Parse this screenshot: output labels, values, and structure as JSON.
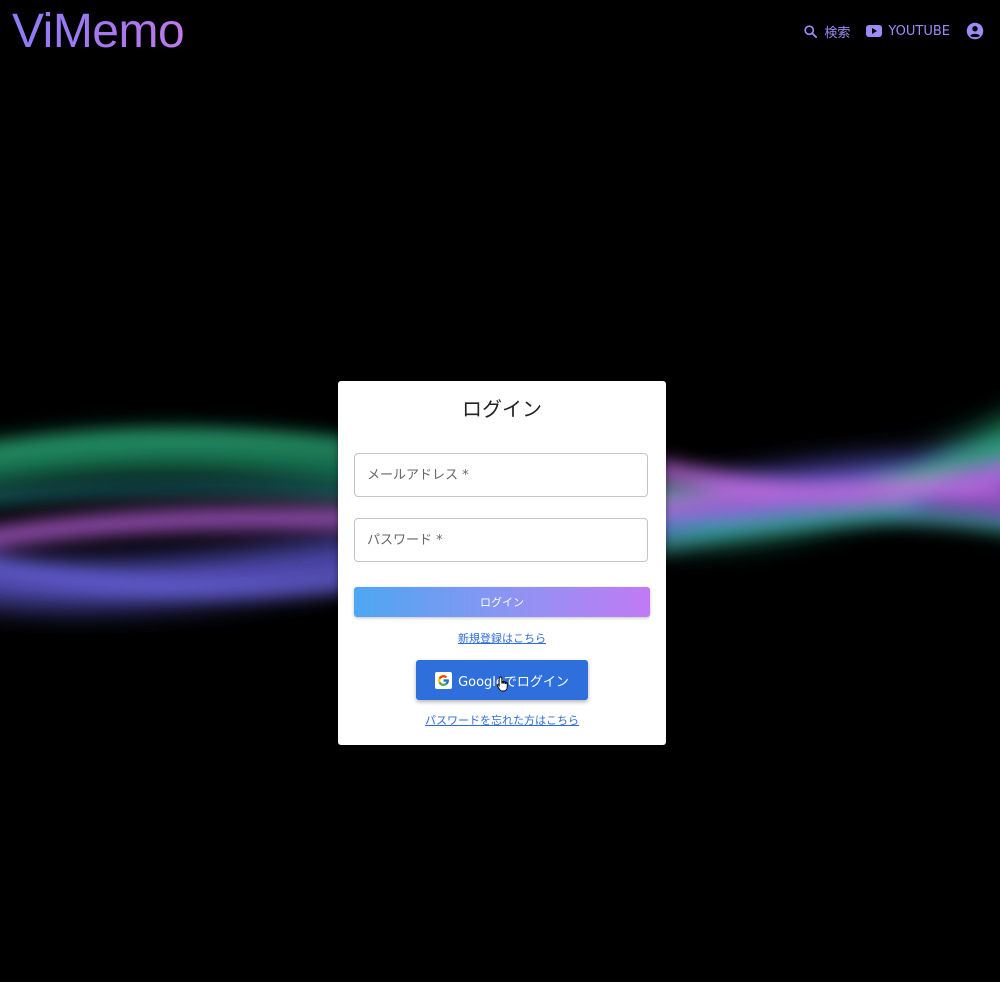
{
  "header": {
    "logo": "ViMemo",
    "nav": {
      "search_label": "検索",
      "youtube_label": "YOUTUBE"
    }
  },
  "login": {
    "title": "ログイン",
    "email_placeholder": "メールアドレス *",
    "password_placeholder": "パスワード *",
    "submit_label": "ログイン",
    "signup_link": "新規登録はこちら",
    "google_label": "Googleでログイン",
    "forgot_link": "パスワードを忘れた方はこちら"
  },
  "icons": {
    "search": "search-icon",
    "youtube": "youtube-icon",
    "account": "account-circle-icon",
    "google": "google-icon",
    "cursor": "hand-pointer-icon"
  },
  "colors": {
    "accent": "#9d8cf3",
    "link": "#2f6cd8",
    "google_button": "#2e6fdc",
    "login_gradient_start": "#4da7f2",
    "login_gradient_end": "#c17af3"
  }
}
